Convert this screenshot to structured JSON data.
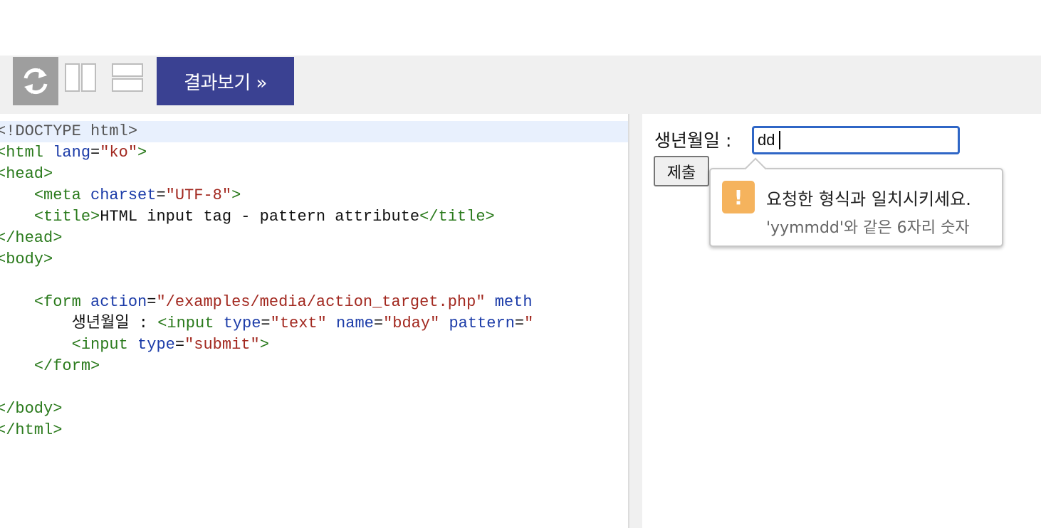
{
  "toolbar": {
    "refresh_icon": "refresh-icon",
    "layout_vertical_icon": "split-vertical-icon",
    "layout_horizontal_icon": "split-horizontal-icon",
    "result_button_label": "결과보기 »",
    "accent_color": "#3a4192"
  },
  "code_lines": [
    "<!DOCTYPE html>",
    "<html lang=\"ko\">",
    "<head>",
    "    <meta charset=\"UTF-8\">",
    "    <title>HTML input tag - pattern attribute</title>",
    "</head>",
    "<body>",
    "",
    "    <form action=\"/examples/media/action_target.php\" meth",
    "        생년월일 : <input type=\"text\" name=\"bday\" pattern=\"",
    "        <input type=\"submit\">",
    "    </form>",
    "",
    "</body>",
    "</html>"
  ],
  "result": {
    "field_label": "생년월일 :",
    "input_value": "dd",
    "submit_label": "제출",
    "tooltip": {
      "icon": "warning-icon",
      "icon_glyph": "!",
      "title": "요청한 형식과 일치시키세요.",
      "subtitle": "'yymmdd'와 같은 6자리 숫자"
    }
  }
}
